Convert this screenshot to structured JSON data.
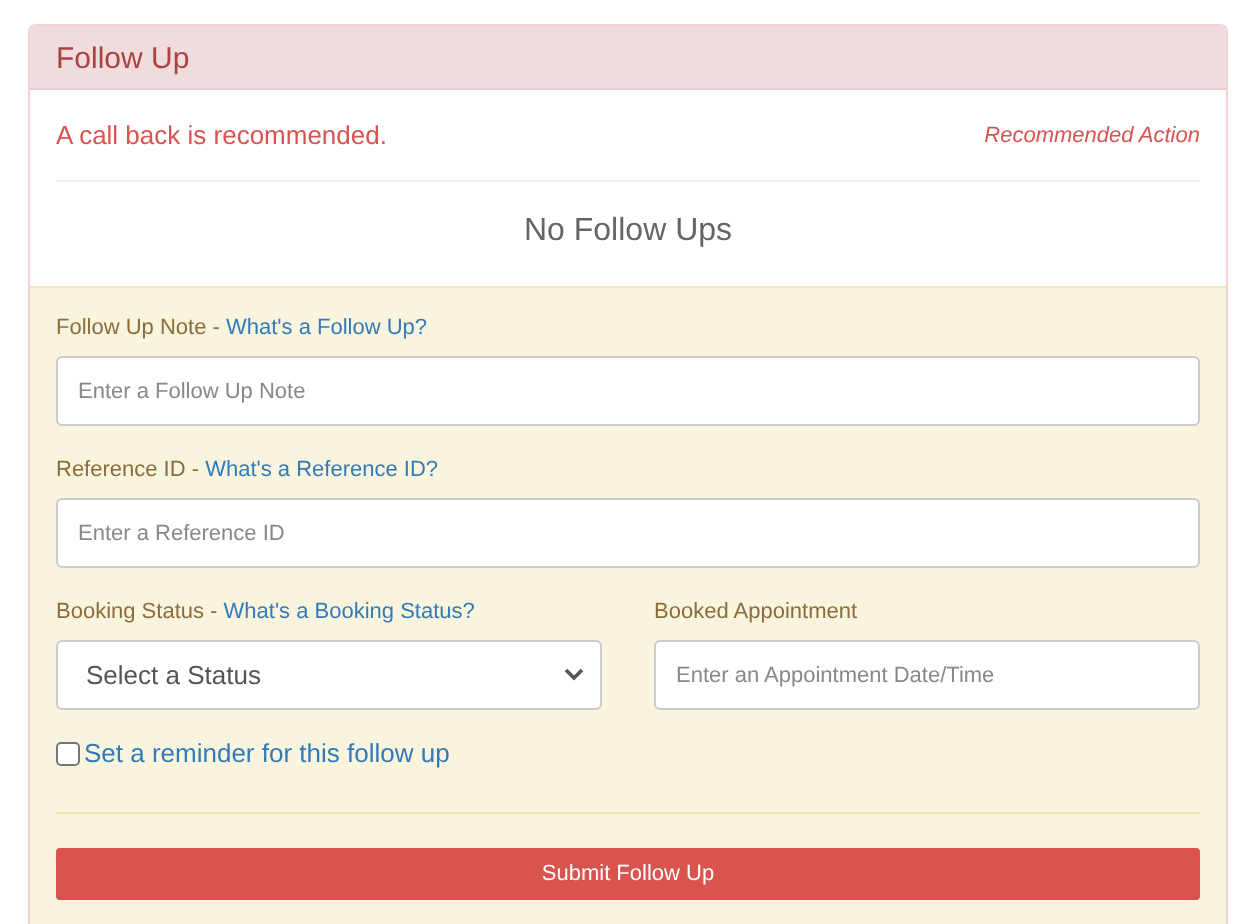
{
  "panel": {
    "title": "Follow Up"
  },
  "alert": {
    "message": "A call back is recommended.",
    "tag": "Recommended Action"
  },
  "empty_state": "No Follow Ups",
  "form": {
    "note": {
      "label": "Follow Up Note - ",
      "help_link": "What's a Follow Up?",
      "placeholder": "Enter a Follow Up Note"
    },
    "reference": {
      "label": "Reference ID - ",
      "help_link": "What's a Reference ID?",
      "placeholder": "Enter a Reference ID"
    },
    "booking_status": {
      "label": "Booking Status - ",
      "help_link": "What's a Booking Status?",
      "value": "Select a Status"
    },
    "appointment": {
      "label": "Booked Appointment",
      "placeholder": "Enter an Appointment Date/Time"
    },
    "reminder": {
      "label": "Set a reminder for this follow up",
      "checked": false
    },
    "submit": "Submit Follow Up"
  }
}
